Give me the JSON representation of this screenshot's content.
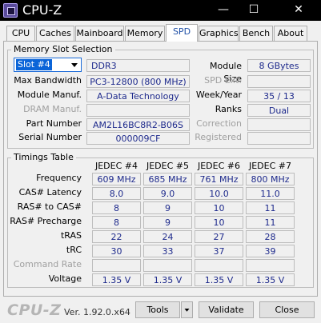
{
  "window": {
    "title": "CPU-Z",
    "minimize": "—",
    "maximize": "☐",
    "close": "✕"
  },
  "tabs": [
    "CPU",
    "Caches",
    "Mainboard",
    "Memory",
    "SPD",
    "Graphics",
    "Bench",
    "About"
  ],
  "active_tab": "SPD",
  "slot_selection": {
    "group_title": "Memory Slot Selection",
    "slot_value": "Slot #4",
    "mem_type": "DDR3",
    "labels": {
      "max_bandwidth": "Max Bandwidth",
      "module_manuf": "Module Manuf.",
      "dram_manuf": "DRAM Manuf.",
      "part_number": "Part Number",
      "serial_number": "Serial Number",
      "module_size": "Module Size",
      "spd_ext": "SPD Ext.",
      "week_year": "Week/Year",
      "ranks": "Ranks",
      "correction": "Correction",
      "registered": "Registered"
    },
    "values": {
      "max_bandwidth": "PC3-12800 (800 MHz)",
      "module_manuf": "A-Data Technology",
      "dram_manuf": "",
      "part_number": "AM2L16BC8R2-B06S",
      "serial_number": "000009CF",
      "module_size": "8 GBytes",
      "spd_ext": "",
      "week_year": "35 / 13",
      "ranks": "Dual",
      "correction": "",
      "registered": ""
    }
  },
  "timings": {
    "group_title": "Timings Table",
    "columns": [
      "JEDEC #4",
      "JEDEC #5",
      "JEDEC #6",
      "JEDEC #7"
    ],
    "rows": [
      {
        "label": "Frequency",
        "dim": false,
        "values": [
          "609 MHz",
          "685 MHz",
          "761 MHz",
          "800 MHz"
        ]
      },
      {
        "label": "CAS# Latency",
        "dim": false,
        "values": [
          "8.0",
          "9.0",
          "10.0",
          "11.0"
        ]
      },
      {
        "label": "RAS# to CAS#",
        "dim": false,
        "values": [
          "8",
          "9",
          "10",
          "11"
        ]
      },
      {
        "label": "RAS# Precharge",
        "dim": false,
        "values": [
          "8",
          "9",
          "10",
          "11"
        ]
      },
      {
        "label": "tRAS",
        "dim": false,
        "values": [
          "22",
          "24",
          "27",
          "28"
        ]
      },
      {
        "label": "tRC",
        "dim": false,
        "values": [
          "30",
          "33",
          "37",
          "39"
        ]
      },
      {
        "label": "Command Rate",
        "dim": true,
        "values": [
          "",
          "",
          "",
          ""
        ]
      },
      {
        "label": "Voltage",
        "dim": false,
        "values": [
          "1.35 V",
          "1.35 V",
          "1.35 V",
          "1.35 V"
        ]
      }
    ]
  },
  "footer": {
    "brand": "CPU-Z",
    "version": "Ver. 1.92.0.x64",
    "tools_label": "Tools",
    "validate_label": "Validate",
    "close_label": "Close"
  },
  "colors": {
    "value_text": "#1e2a8c",
    "active_tab_text": "#1f4fa6",
    "brand_grey": "#b5b5b5",
    "select_highlight": "#0a64d8"
  }
}
